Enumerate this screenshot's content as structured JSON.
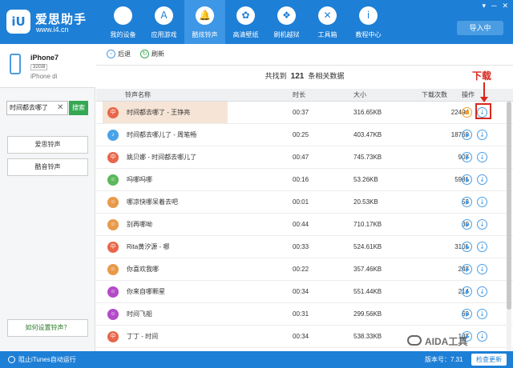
{
  "app": {
    "name": "爱思助手",
    "url": "www.i4.cn"
  },
  "nav": {
    "items": [
      {
        "label": "我的设备",
        "icon": ""
      },
      {
        "label": "应用游戏",
        "icon": "A"
      },
      {
        "label": "酷炫铃声",
        "icon": "🔔"
      },
      {
        "label": "高清壁纸",
        "icon": "✿"
      },
      {
        "label": "刷机越狱",
        "icon": "❖"
      },
      {
        "label": "工具箱",
        "icon": "✕"
      },
      {
        "label": "教程中心",
        "icon": "i"
      }
    ],
    "active_index": 2
  },
  "window": {
    "controls": [
      "▾",
      "─",
      "✕"
    ],
    "import_label": "导入中"
  },
  "device": {
    "name": "iPhone7",
    "capacity": "32GB",
    "model": "iPhone di"
  },
  "search": {
    "value": "时间都去哪了",
    "clear": "✕",
    "button": "搜索"
  },
  "sidebar": {
    "btn1": "爱思铃声",
    "btn2": "酷音铃声",
    "howto": "如何设置铃声？"
  },
  "toolbar": {
    "back": "后退",
    "refresh": "刷新"
  },
  "summary": {
    "prefix": "共找到",
    "count": "121",
    "suffix": "条相关数据"
  },
  "annotation": {
    "download": "下载"
  },
  "table": {
    "headers": {
      "name": "铃声名称",
      "duration": "时长",
      "size": "大小",
      "count": "下载次数",
      "ops": "操作"
    },
    "rows": [
      {
        "name": "时间都去哪了 - 王铮亮",
        "duration": "00:37",
        "size": "316.65KB",
        "count": "22494",
        "avatar": "中",
        "color": "#e8664a"
      },
      {
        "name": "时间都去哪儿了 - 周笔畅",
        "duration": "00:25",
        "size": "403.47KB",
        "count": "18769",
        "avatar": "♪",
        "color": "#4aa3e8"
      },
      {
        "name": "姚贝娜 - 时间都去哪儿了",
        "duration": "00:47",
        "size": "745.73KB",
        "count": "907",
        "avatar": "中",
        "color": "#e8664a"
      },
      {
        "name": "吗哪吗哪",
        "duration": "00:16",
        "size": "53.26KB",
        "count": "5981",
        "avatar": "☺",
        "color": "#5cb85c"
      },
      {
        "name": "哪凉快哪呆着去吧",
        "duration": "00:01",
        "size": "20.53KB",
        "count": "53",
        "avatar": "☺",
        "color": "#e89a4a"
      },
      {
        "name": "别再哪呦",
        "duration": "00:44",
        "size": "710.17KB",
        "count": "30",
        "avatar": "☺",
        "color": "#e89a4a"
      },
      {
        "name": "Rita黄汐源 - 哪",
        "duration": "00:33",
        "size": "524.61KB",
        "count": "3101",
        "avatar": "中",
        "color": "#e8664a"
      },
      {
        "name": "你喜欢我哪",
        "duration": "00:22",
        "size": "357.46KB",
        "count": "247",
        "avatar": "☺",
        "color": "#e89a4a"
      },
      {
        "name": "你来自哪颗星",
        "duration": "00:34",
        "size": "551.44KB",
        "count": "214",
        "avatar": "☺",
        "color": "#b44ac8"
      },
      {
        "name": "时间飞船",
        "duration": "00:31",
        "size": "299.56KB",
        "count": "69",
        "avatar": "☺",
        "color": "#b44ac8"
      },
      {
        "name": "丁丁 - 时间",
        "duration": "00:34",
        "size": "538.33KB",
        "count": "137",
        "avatar": "中",
        "color": "#e8664a"
      }
    ]
  },
  "footer": {
    "itunes": "阻止iTunes自动运行",
    "version": "版本号：7.31",
    "check": "检查更新"
  },
  "watermark": "AIDA工具"
}
